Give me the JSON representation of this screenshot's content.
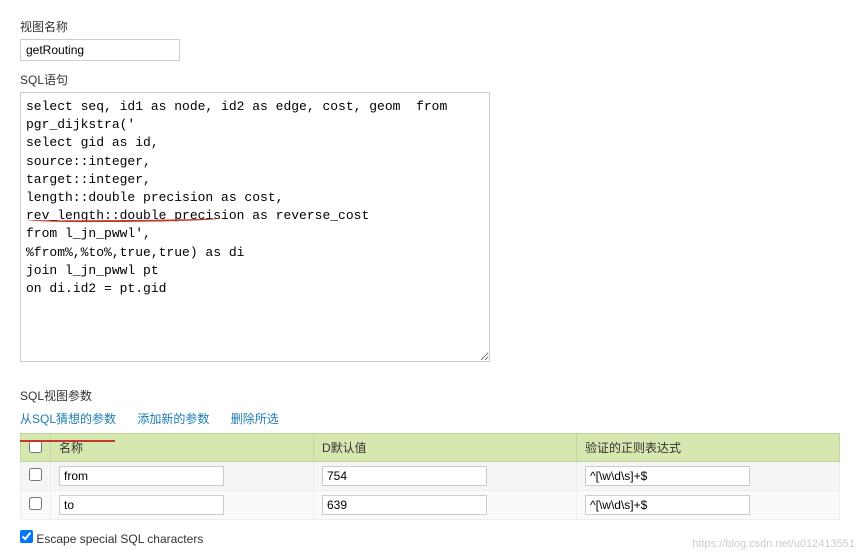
{
  "labels": {
    "view_name": "视图名称",
    "sql_statement": "SQL语句",
    "sql_view_params": "SQL视图参数"
  },
  "view_name_value": "getRouting",
  "sql_text": "select seq, id1 as node, id2 as edge, cost, geom  from\npgr_dijkstra('\nselect gid as id,\nsource::integer,\ntarget::integer,\nlength::double precision as cost,\nrev_length::double precision as reverse_cost\nfrom l_jn_pwwl',\n%from%,%to%,true,true) as di\njoin l_jn_pwwl pt\non di.id2 = pt.gid",
  "links": {
    "guess": "从SQL猜想的参数",
    "add": "添加新的参数",
    "remove": "删除所选"
  },
  "table": {
    "headers": {
      "name": "名称",
      "default": "D默认值",
      "regex": "验证的正则表达式"
    },
    "rows": [
      {
        "name": "from",
        "default": "754",
        "regex": "^[\\w\\d\\s]+$"
      },
      {
        "name": "to",
        "default": "639",
        "regex": "^[\\w\\d\\s]+$"
      }
    ]
  },
  "escape_label": "Escape special SQL characters",
  "watermark": "https://blog.csdn.net/u012413551"
}
